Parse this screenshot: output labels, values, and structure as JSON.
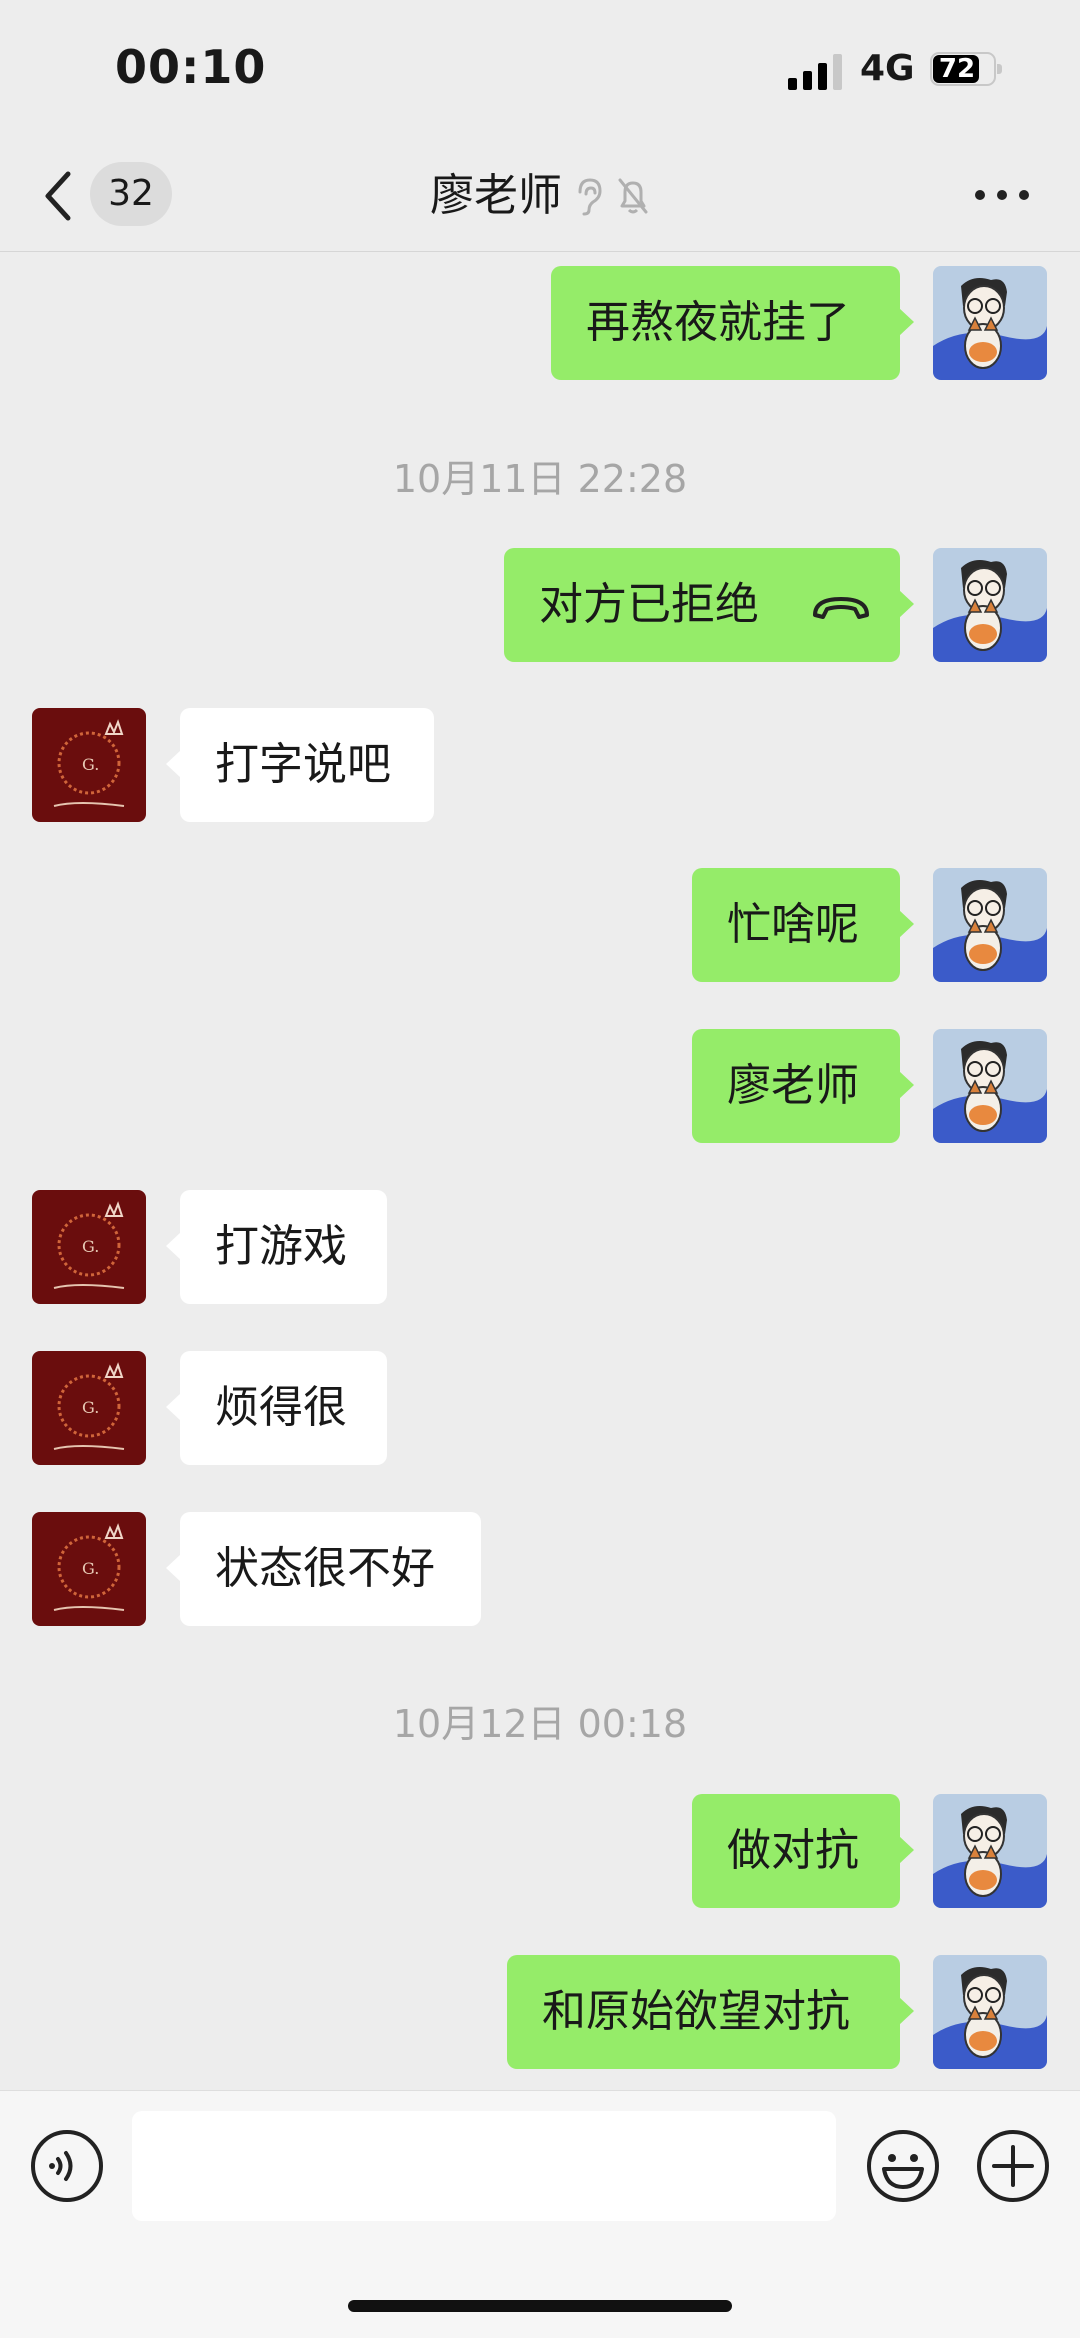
{
  "status_bar": {
    "time": "00:10",
    "network": "4G",
    "battery": "72"
  },
  "nav": {
    "unread_count": "32",
    "title": "廖老师",
    "icons": [
      "ear-icon",
      "mute-bell-icon"
    ]
  },
  "colors": {
    "background": "#ededed",
    "outgoing_bubble": "#95ec69",
    "incoming_bubble": "#ffffff",
    "timestamp": "#a6a6a6"
  },
  "messages": [
    {
      "direction": "out",
      "text": "再熬夜就挂了"
    },
    {
      "type": "timestamp",
      "text": "10月11日 22:28"
    },
    {
      "direction": "out",
      "text": "对方已拒绝",
      "icon": "phone-hangup-icon"
    },
    {
      "direction": "in",
      "text": "打字说吧"
    },
    {
      "direction": "out",
      "text": "忙啥呢"
    },
    {
      "direction": "out",
      "text": "廖老师"
    },
    {
      "direction": "in",
      "text": "打游戏"
    },
    {
      "direction": "in",
      "text": "烦得很"
    },
    {
      "direction": "in",
      "text": "状态很不好"
    },
    {
      "type": "timestamp",
      "text": "10月12日 00:18"
    },
    {
      "direction": "out",
      "text": "做对抗"
    },
    {
      "direction": "out",
      "text": "和原始欲望对抗"
    }
  ],
  "input_bar": {
    "value": "",
    "icons": [
      "voice-icon",
      "emoji-icon",
      "plus-icon"
    ]
  }
}
